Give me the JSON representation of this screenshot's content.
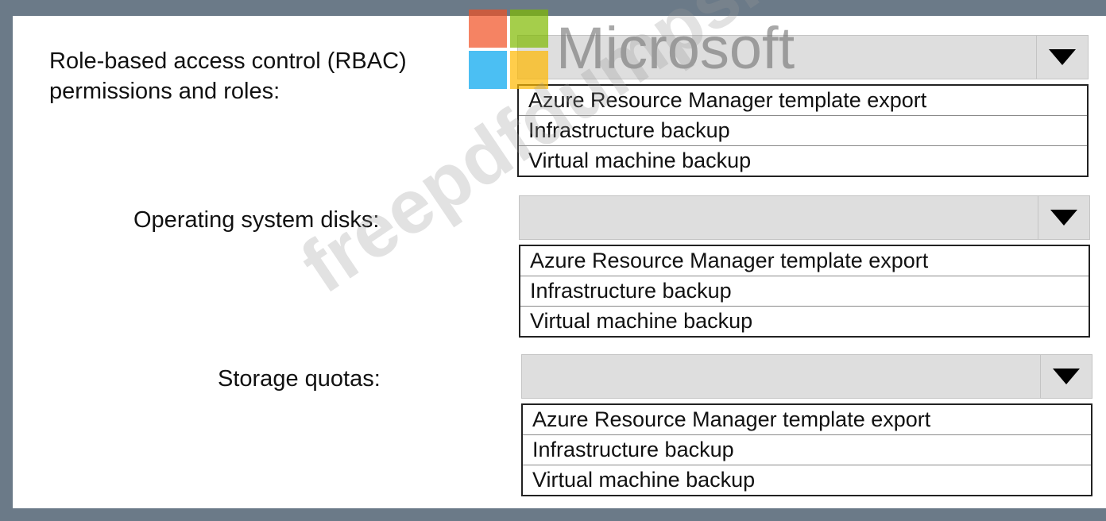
{
  "rows": [
    {
      "label": "Role-based access control (RBAC) permissions and roles:",
      "selected": "",
      "options": [
        "Azure Resource Manager template export",
        "Infrastructure backup",
        "Virtual machine backup"
      ]
    },
    {
      "label": "Operating system disks:",
      "selected": "",
      "options": [
        "Azure Resource Manager template export",
        "Infrastructure backup",
        "Virtual machine backup"
      ]
    },
    {
      "label": "Storage quotas:",
      "selected": "",
      "options": [
        "Azure Resource Manager template export",
        "Infrastructure backup",
        "Virtual machine backup"
      ]
    }
  ],
  "watermark": {
    "logo_text": "Microsoft",
    "site_text": "freepdfdumps.com"
  },
  "colors": {
    "frame": "#6b7a88",
    "panel": "#ffffff",
    "select_bg": "#dedede"
  }
}
